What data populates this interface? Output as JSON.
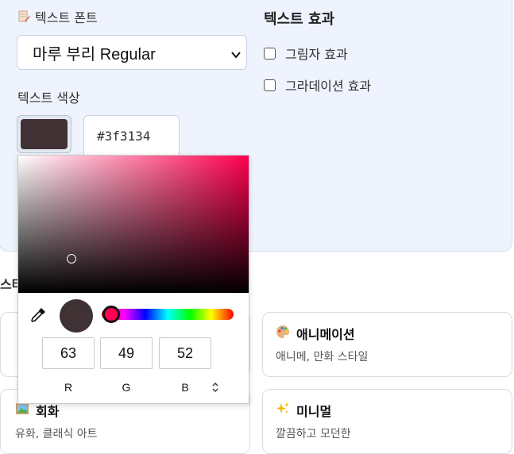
{
  "text_font": {
    "label": "텍스트 폰트",
    "selected": "마루 부리 Regular"
  },
  "text_color": {
    "label": "텍스트 색상",
    "hex": "#3f3134",
    "swatch_color": "#3f3134"
  },
  "text_effects": {
    "title": "텍스트 효과",
    "options": [
      {
        "label": "그림자 효과",
        "checked": false
      },
      {
        "label": "그라데이션 효과",
        "checked": false
      }
    ]
  },
  "style_section": {
    "label_partial": "스타",
    "cards": [
      {
        "title": "",
        "desc": "",
        "icon": "partial-icon"
      },
      {
        "title": "애니메이션",
        "desc": "애니메, 만화 스타일",
        "icon": "palette-icon"
      },
      {
        "title": "회화",
        "desc": "유화, 클래식 아트",
        "icon": "framed-picture-icon"
      },
      {
        "title": "미니멀",
        "desc": "깔끔하고 모던한",
        "icon": "sparkles-icon"
      }
    ]
  },
  "color_picker": {
    "base_hue_color": "#ff0050",
    "saturation": 0.23,
    "value": 0.25,
    "hue_fraction": 0.07,
    "r": "63",
    "g": "49",
    "b": "52",
    "r_label": "R",
    "g_label": "G",
    "b_label": "B"
  }
}
